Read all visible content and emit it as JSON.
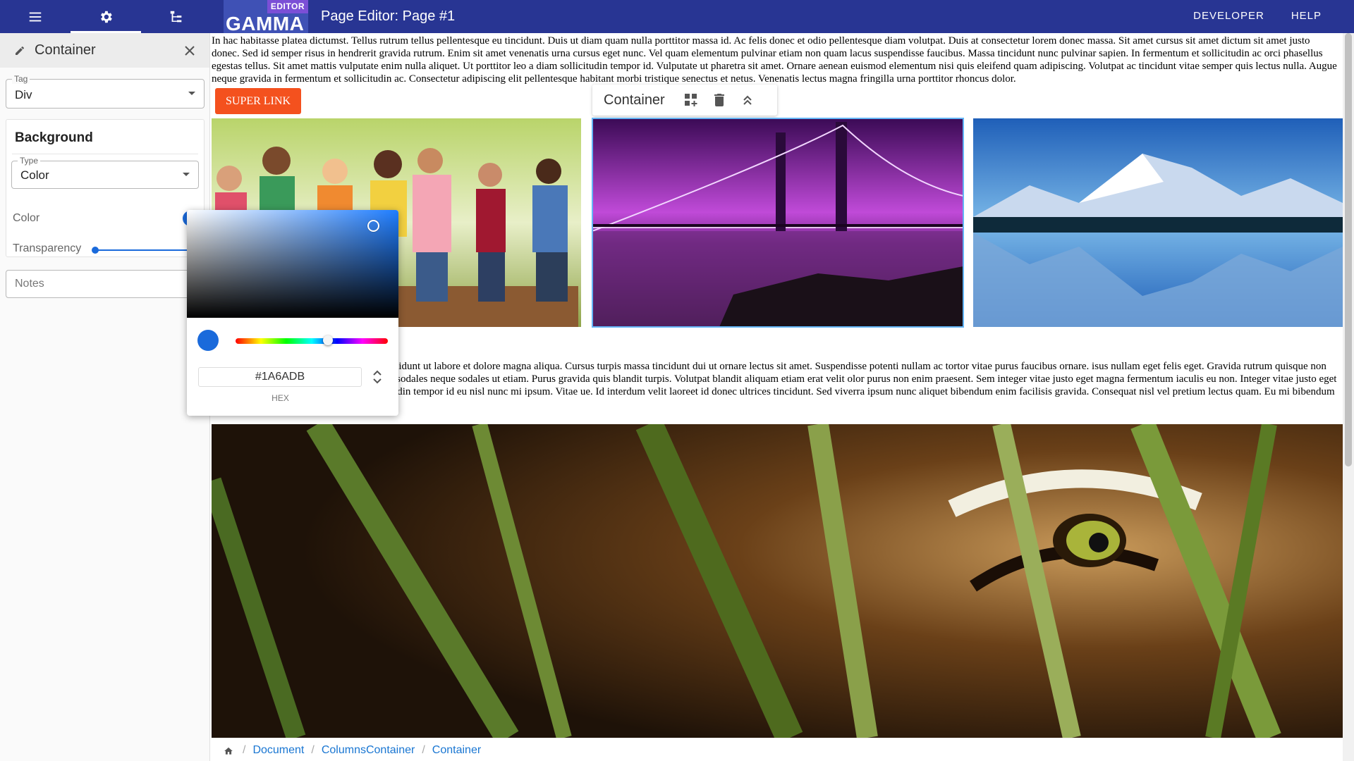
{
  "appbar": {
    "logo_text": "GAMMA",
    "logo_badge": "EDITOR",
    "page_title": "Page Editor: Page #1",
    "links": [
      "DEVELOPER",
      "HELP"
    ]
  },
  "panel": {
    "title": "Container",
    "tag": {
      "label": "Tag",
      "value": "Div"
    },
    "background": {
      "title": "Background",
      "type": {
        "label": "Type",
        "value": "Color"
      },
      "color_label": "Color",
      "transparency_label": "Transparency",
      "color_value": "#1A6ADB"
    },
    "notes_placeholder": "Notes"
  },
  "picker": {
    "hex_value": "#1A6ADB",
    "hex_label": "HEX"
  },
  "canvas": {
    "paragraph1": "In hac habitasse platea dictumst. Tellus rutrum tellus pellentesque eu tincidunt. Duis ut diam quam nulla porttitor massa id. Ac felis donec et odio pellentesque diam volutpat. Duis at consectetur lorem donec massa. Sit amet cursus sit amet dictum sit amet justo donec. Sed id semper risus in hendrerit gravida rutrum. Enim sit amet venenatis urna cursus eget nunc. Vel quam elementum pulvinar etiam non quam lacus suspendisse faucibus. Massa tincidunt nunc pulvinar sapien. In fermentum et sollicitudin ac orci phasellus egestas tellus. Sit amet mattis vulputate enim nulla aliquet. Ut porttitor leo a diam sollicitudin tempor id. Vulputate ut pharetra sit amet. Ornare aenean euismod elementum nisi quis eleifend quam adipiscing. Volutpat ac tincidunt vitae semper quis lectus nulla. Augue neque gravida in fermentum et sollicitudin ac. Consectetur adipiscing elit pellentesque habitant morbi tristique senectus et netus. Venenatis lectus magna fringilla urna porttitor rhoncus dolor.",
    "super_link": "SUPER LINK",
    "selected_toolbar_label": "Container",
    "paragraph2": "adipiscing elit, sed do eiusmod tempor incididunt ut labore et dolore magna aliqua. Cursus turpis massa tincidunt dui ut ornare lectus sit amet. Suspendisse potenti nullam ac tortor vitae purus faucibus ornare. isus nullam eget felis eget. Gravida rutrum quisque non tellus. Velit egestas dui id ornare arcu. Non sodales neque sodales ut etiam. Purus gravida quis blandit turpis. Volutpat blandit aliquam etiam erat velit olor purus non enim praesent. Sem integer vitae justo eget magna fermentum iaculis eu non. Integer vitae justo eget magna fermentum iaculis eu. Diam sollicitudin tempor id eu nisl nunc mi ipsum. Vitae ue. Id interdum velit laoreet id donec ultrices tincidunt. Sed viverra ipsum nunc aliquet bibendum enim facilisis gravida. Consequat nisl vel pretium lectus quam. Eu mi bibendum neque egestas congue quisque egestas."
  },
  "breadcrumb": [
    "Document",
    "ColumnsContainer",
    "Container"
  ],
  "colors": {
    "appbar": "#283593",
    "accent": "#1A6ADB",
    "super_link": "#f4511e"
  },
  "icons": [
    "menu-icon",
    "gear-icon",
    "tree-icon",
    "pencil-icon",
    "close-icon",
    "add-grid-icon",
    "trash-icon",
    "chevron-double-up-icon",
    "home-icon",
    "unfold-icon"
  ]
}
